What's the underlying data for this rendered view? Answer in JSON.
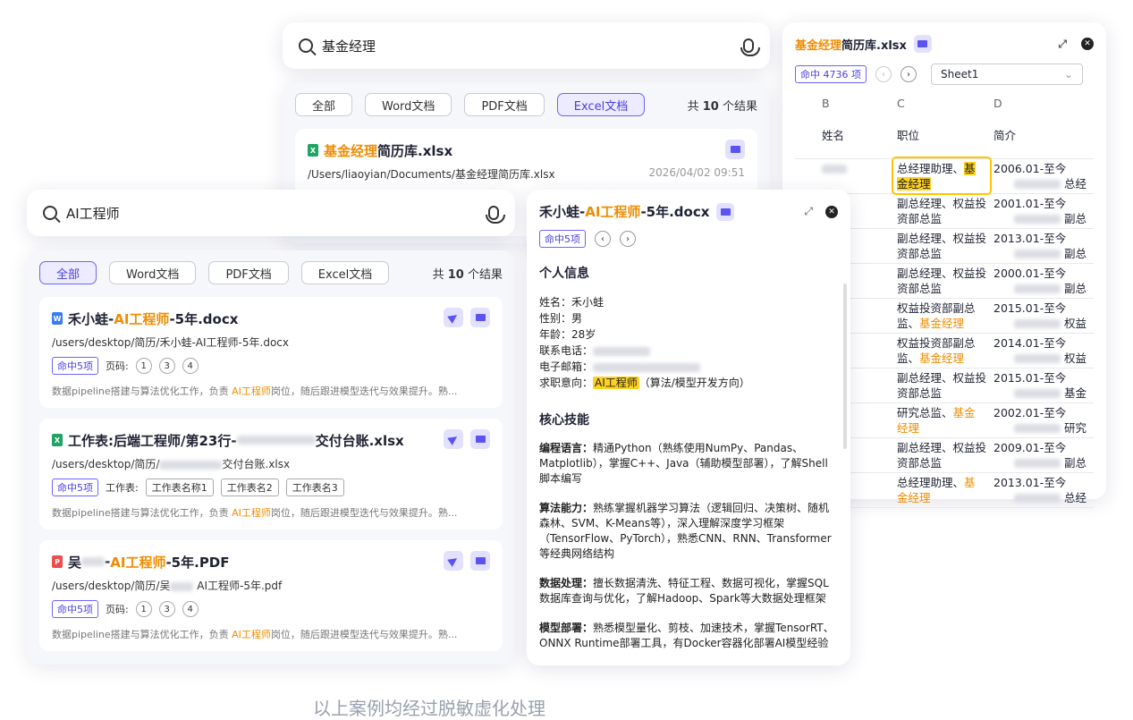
{
  "back_search": {
    "query": "基金经理"
  },
  "back_panel": {
    "tabs": [
      "全部",
      "Word文档",
      "PDF文档",
      "Excel文档"
    ],
    "count_prefix": "共",
    "count_num": "10",
    "count_suffix": "个结果",
    "result": {
      "title_hl": "基金经理",
      "title_rest": "简历库.xlsx",
      "path": "/Users/liaoyian/Documents/基金经理简历库.xlsx",
      "date": "2026/04/02 09:51"
    }
  },
  "excel_preview": {
    "title_hl": "基金经理",
    "title_rest": "简历库.xlsx",
    "hits": "命中 4736 项",
    "sheet": "Sheet1",
    "cols": [
      "B",
      "C",
      "D"
    ],
    "headers": [
      "姓名",
      "职位",
      "简介"
    ],
    "rows": [
      {
        "pos": "总经理助理、",
        "pos_hl": "基金经理",
        "d1": "2006.01-至今",
        "d2": "总经"
      },
      {
        "pos": "副总经理、权益投资部总监",
        "pos_hl": "",
        "d1": "2001.01-至今",
        "d2": "副总"
      },
      {
        "pos": "副总经理、权益投资部总监",
        "pos_hl": "",
        "d1": "2013.01-至今",
        "d2": "副总"
      },
      {
        "pos": "副总经理、权益投资部总监",
        "pos_hl": "",
        "d1": "2000.01-至今",
        "d2": "副总"
      },
      {
        "pos": "权益投资部副总监、",
        "pos_hl": "基金经理",
        "d1": "2015.01-至今",
        "d2": "权益"
      },
      {
        "pos": "权益投资部副总监、",
        "pos_hl": "基金经理",
        "d1": "2014.01-至今",
        "d2": "权益"
      },
      {
        "pos": "副总经理、权益投资部总监",
        "pos_hl": "",
        "d1": "2015.01-至今",
        "d2": "基金"
      },
      {
        "pos": "研究总监、",
        "pos_hl": "基金经理",
        "d1": "2002.01-至今",
        "d2": "研究"
      },
      {
        "pos": "副总经理、权益投资部总监",
        "pos_hl": "",
        "d1": "2009.01-至今",
        "d2": "副总"
      },
      {
        "pos": "总经理助理、",
        "pos_hl": "基金经理",
        "d1": "2013.01-至今",
        "d2": "总经"
      }
    ]
  },
  "front_search": {
    "query": "AI工程师"
  },
  "front_panel": {
    "tabs": [
      "全部",
      "Word文档",
      "PDF文档",
      "Excel文档"
    ],
    "count_prefix": "共",
    "count_num": "10",
    "count_suffix": "个结果",
    "results": [
      {
        "type": "W",
        "t1": "禾小蛙-",
        "thl": "AI工程师",
        "t2": "-5年.docx",
        "path": "/users/desktop/简历/禾小蛙-AI工程师-5年.docx",
        "hits": "命中5项",
        "meta_label": "页码:",
        "pages": [
          "1",
          "3",
          "4"
        ]
      },
      {
        "type": "X",
        "t1": "工作表:后端工程师/第23行-",
        "thl": "",
        "t2": "交付台账.xlsx",
        "path_a": "/users/desktop/简历/",
        "path_b": "交付台账.xlsx",
        "hits": "命中5项",
        "meta_label": "工作表:",
        "sheets": [
          "工作表名称1",
          "工作表名2",
          "工作表名3"
        ]
      },
      {
        "type": "P",
        "t1": "吴",
        "thl": "AI工程师",
        "t2": "-5年.PDF",
        "path_a": "/users/desktop/简历/吴",
        "path_b": " AI工程师-5年.pdf",
        "hits": "命中5项",
        "meta_label": "页码:",
        "pages": [
          "1",
          "3",
          "4"
        ]
      }
    ],
    "snippet_a": "数据pipeline搭建与算法优化工作，负责 ",
    "snippet_hl": "AI工程师",
    "snippet_b": "岗位，随后跟进模型迭代与效果提升。熟..."
  },
  "detail": {
    "title_a": "禾小蛙-",
    "title_hl": "AI工程师",
    "title_b": "-5年.docx",
    "hits": "命中5项",
    "sec1": "个人信息",
    "info": [
      "姓名：禾小蛙",
      "性别：男",
      "年龄：28岁",
      "联系电话：",
      "电子邮箱："
    ],
    "intent_label": "求职意向：",
    "intent_hl": "AI工程师",
    "intent_rest": "（算法/模型开发方向）",
    "sec2": "核心技能",
    "skills": [
      {
        "k": "编程语言：",
        "v": "精通Python（熟练使用NumPy、Pandas、Matplotlib），掌握C++、Java（辅助模型部署），了解Shell脚本编写"
      },
      {
        "k": "算法能力：",
        "v": "熟练掌握机器学习算法（逻辑回归、决策树、随机森林、SVM、K-Means等），深入理解深度学习框架（TensorFlow、PyTorch），熟悉CNN、RNN、Transformer等经典网络结构"
      },
      {
        "k": "数据处理：",
        "v": "擅长数据清洗、特征工程、数据可视化，掌握SQL数据库查询与优化，了解Hadoop、Spark等大数据处理框架"
      },
      {
        "k": "模型部署：",
        "v": "熟悉模型量化、剪枝、加速技术，掌握TensorRT、ONNX Runtime部署工具，有Docker容器化部署AI模型经验"
      }
    ]
  },
  "caption": "以上案例均经过脱敏虚化处理"
}
